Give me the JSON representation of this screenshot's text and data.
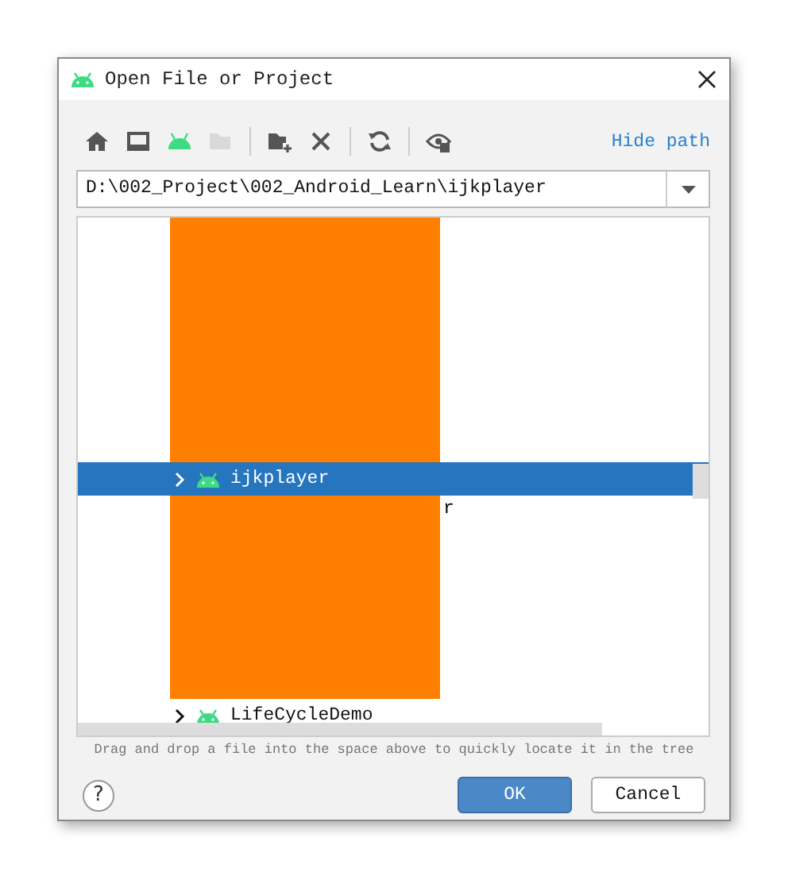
{
  "window": {
    "title": "Open File or Project"
  },
  "toolbar": {
    "buttons": [
      {
        "disabled": false
      },
      {
        "disabled": false
      },
      {
        "disabled": false
      },
      {
        "disabled": true
      },
      {
        "disabled": false
      },
      {
        "disabled": false
      },
      {
        "disabled": false
      },
      {
        "disabled": false
      }
    ],
    "hide_path_link": "Hide path"
  },
  "path_field": {
    "value": "D:\\002_Project\\002_Android_Learn\\ijkplayer"
  },
  "tree": {
    "rows": [
      {
        "kind": "redacted"
      },
      {
        "kind": "folder",
        "label": "ijkplayer",
        "selected": true,
        "expanded": false
      },
      {
        "kind": "redacted",
        "trailing": "r"
      },
      {
        "kind": "folder",
        "label": "LifeCycleDemo",
        "selected": false,
        "expanded": false
      }
    ]
  },
  "hint": "Drag and drop a file into the space above to quickly locate it in the tree",
  "help_button": "?",
  "buttons": [
    {
      "label": "OK",
      "primary": true
    },
    {
      "label": "Cancel",
      "primary": false
    }
  ]
}
